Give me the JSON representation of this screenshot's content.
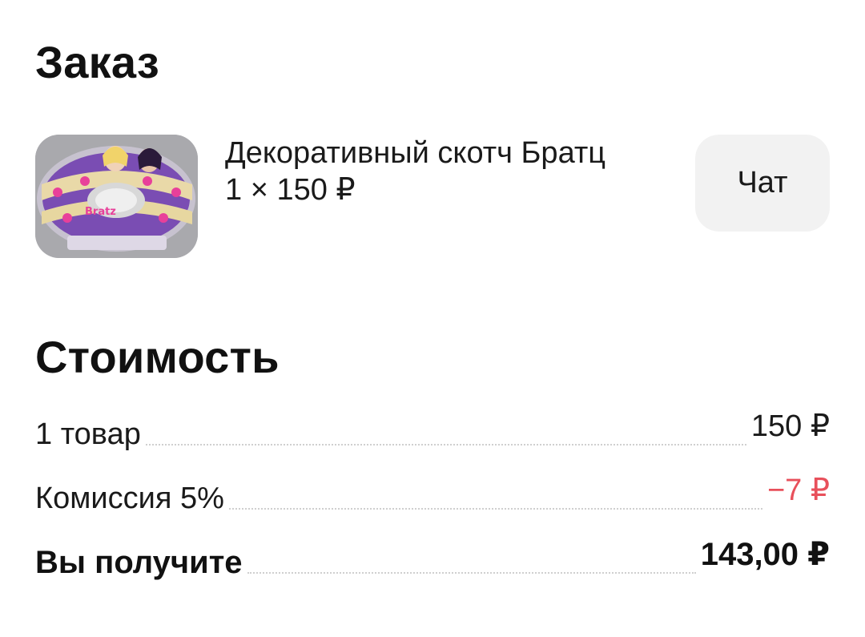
{
  "order": {
    "title": "Заказ",
    "product": {
      "name": "Декоративный скотч Братц",
      "quantity_price": "1 × 150 ₽",
      "image_text": "Bratz"
    },
    "chat_label": "Чат"
  },
  "cost": {
    "title": "Стоимость",
    "rows": [
      {
        "label": "1 товар",
        "value": "150 ₽"
      },
      {
        "label": "Комиссия 5%",
        "value": "−7 ₽"
      },
      {
        "label": "Вы получите",
        "value": "143,00 ₽"
      }
    ]
  },
  "colors": {
    "negative": "#e8505b",
    "chat_background": "#f2f2f2",
    "text": "#111111"
  }
}
